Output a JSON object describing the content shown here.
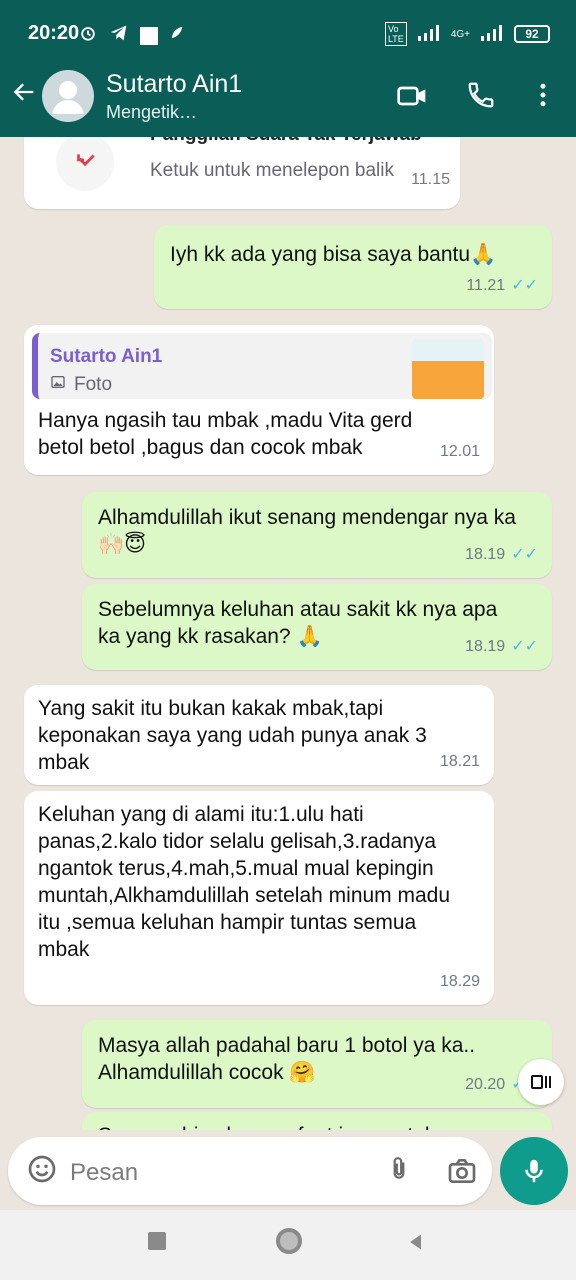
{
  "status_bar": {
    "time": "20:20",
    "battery": "92",
    "network": "4G+"
  },
  "header": {
    "contact_name": "Sutarto Ain1",
    "contact_status": "Mengetik…"
  },
  "call_card": {
    "title": "Panggilan Suara Tak Terjawab",
    "subtitle": "Ketuk untuk menelepon balik",
    "time": "11.15"
  },
  "messages": [
    {
      "text": "Iyh kk ada yang bisa saya bantu🙏",
      "time": "11.21"
    },
    {
      "quote_name": "Sutarto Ain1",
      "quote_type": "Foto",
      "text": "Hanya ngasih tau mbak ,madu Vita gerd betol betol ,bagus dan cocok mbak",
      "time": "12.01"
    },
    {
      "text": "Alhamdulillah ikut senang mendengar nya ka 🙌🏻😇",
      "time": "18.19"
    },
    {
      "text": "Sebelumnya keluhan atau sakit kk nya apa ka yang kk rasakan? 🙏",
      "time": "18.19"
    },
    {
      "text": "Yang sakit itu bukan kakak mbak,tapi keponakan saya yang udah punya anak 3 mbak",
      "time": "18.21"
    },
    {
      "text": "Keluhan yang di alami itu:1.ulu hati panas,2.kalo tidor selalu gelisah,3.radanya ngantok terus,4.mah,5.mual mual kepingin muntah,Alkhamdulillah setelah minum madu itu ,semua keluhan hampir tuntas semua mbak",
      "time": "18.29"
    },
    {
      "text": "Masya allah padahal baru 1 botol ya ka.. Alhamdulillah cocok 🤗",
      "time": "20.20"
    },
    {
      "text": "Semoga bisa bermanfaat juga untuk"
    }
  ],
  "composer": {
    "placeholder": "Pesan"
  }
}
